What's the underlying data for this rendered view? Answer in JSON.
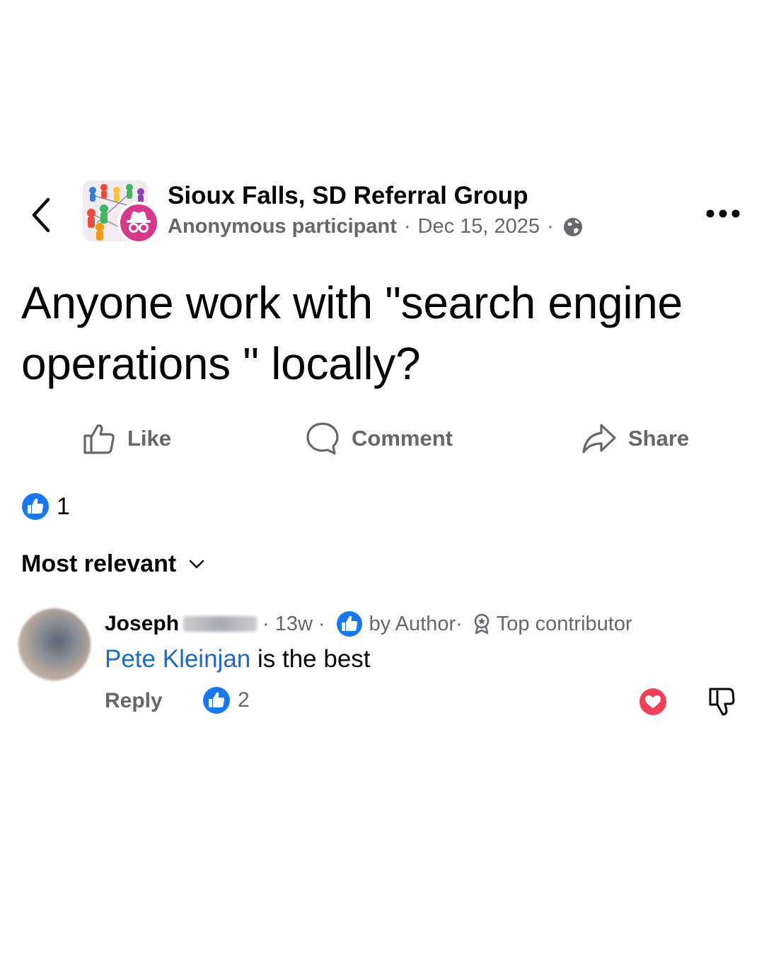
{
  "header": {
    "group_name": "Sioux Falls, SD Referral Group",
    "author": "Anonymous participant",
    "date": "Dec 15, 2025",
    "separator": "·",
    "icons": {
      "back": "chevron-left-icon",
      "privacy": "globe-icon",
      "more": "more-horizontal-icon",
      "anon": "incognito-icon"
    }
  },
  "post": {
    "text": "Anyone work with \"search engine operations \" locally?"
  },
  "actions": {
    "like_label": "Like",
    "comment_label": "Comment",
    "share_label": "Share"
  },
  "reactions": {
    "count": "1"
  },
  "comments_sort": {
    "label": "Most relevant"
  },
  "comment": {
    "author_first": "Joseph",
    "time": "13w",
    "liked_by": "by Author",
    "badge": "Top contributor",
    "mention": "Pete Kleinjan",
    "text_rest": " is the best",
    "reply_label": "Reply",
    "likes": "2"
  },
  "colors": {
    "text_primary": "#050505",
    "text_secondary": "#65676b",
    "link_blue": "#1b6ac6",
    "like_blue": "#1877f2",
    "anon_pink": "#d6388a",
    "heart_red": "#f33e58"
  }
}
